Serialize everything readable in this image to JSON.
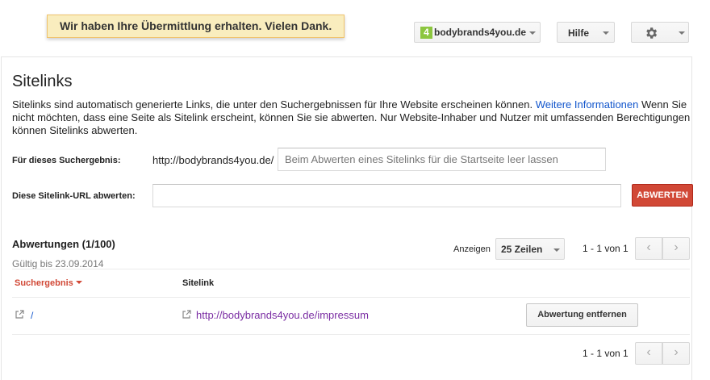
{
  "notice": {
    "text": "Wir haben Ihre Übermittlung erhalten. Vielen Dank."
  },
  "header": {
    "site_badge": "4",
    "site_name": "bodybrands4you.de",
    "help_label": "Hilfe",
    "settings_icon": "gear-icon"
  },
  "page": {
    "title": "Sitelinks",
    "description_before": "Sitelinks sind automatisch generierte Links, die unter den Suchergebnissen für Ihre Website erscheinen können. ",
    "description_link": "Weitere Informationen",
    "description_after": " Wenn Sie nicht möchten, dass eine Seite als Sitelink erscheint, können Sie sie abwerten. Nur Website-Inhaber und Nutzer mit umfassenden Berechtigungen können Sitelinks abwerten."
  },
  "form": {
    "search_result_label": "Für dieses Suchergebnis:",
    "search_result_prefix": "http://bodybrands4you.de/",
    "search_result_placeholder": "Beim Abwerten eines Sitelinks für die Startseite leer lassen",
    "search_result_value": "",
    "sitelink_url_label": "Diese Sitelink-URL abwerten:",
    "sitelink_url_value": "",
    "submit_label": "ABWERTEN"
  },
  "demotions": {
    "title": "Abwertungen (1/100)",
    "valid_until": "Gültig bis 23.09.2014",
    "show_label": "Anzeigen",
    "rows_per_page": "25 Zeilen",
    "pagination_top": "1 - 1 von 1",
    "pagination_bottom": "1 - 1 von 1",
    "columns": {
      "search_result": "Suchergebnis",
      "sitelink": "Sitelink"
    },
    "rows": [
      {
        "search_result": "/",
        "sitelink": "http://bodybrands4you.de/impressum",
        "action": "Abwertung entfernen"
      }
    ]
  },
  "colors": {
    "accent_red": "#d14836",
    "link_blue": "#1155cc",
    "visited_purple": "#7a2da3",
    "badge_green": "#8cc63f"
  }
}
